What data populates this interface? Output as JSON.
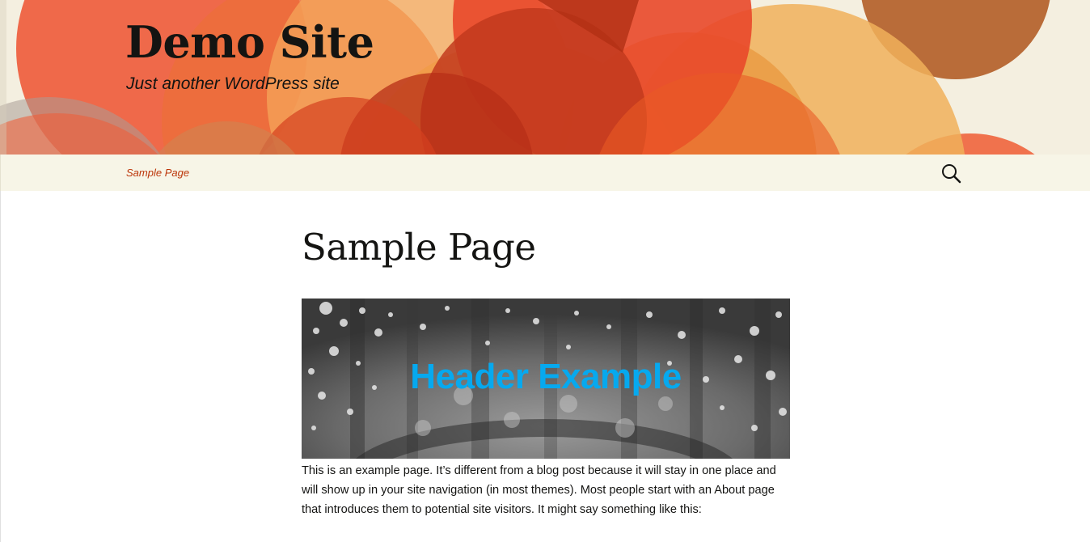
{
  "site": {
    "title": "Demo Site",
    "description": "Just another WordPress site"
  },
  "nav": {
    "items": [
      {
        "label": "Sample Page"
      }
    ],
    "search_icon": "search-icon"
  },
  "page": {
    "title": "Sample Page",
    "image_caption": "Header Example",
    "body": "This is an example page. It’s different from a blog post because it will stay in one place and will show up in your site navigation (in most themes). Most people start with an About page that introduces them to potential site visitors. It might say something like this:"
  },
  "colors": {
    "link": "#bc360a",
    "image_caption": "#06a9ef",
    "navbar_bg": "#f7f5e7"
  }
}
